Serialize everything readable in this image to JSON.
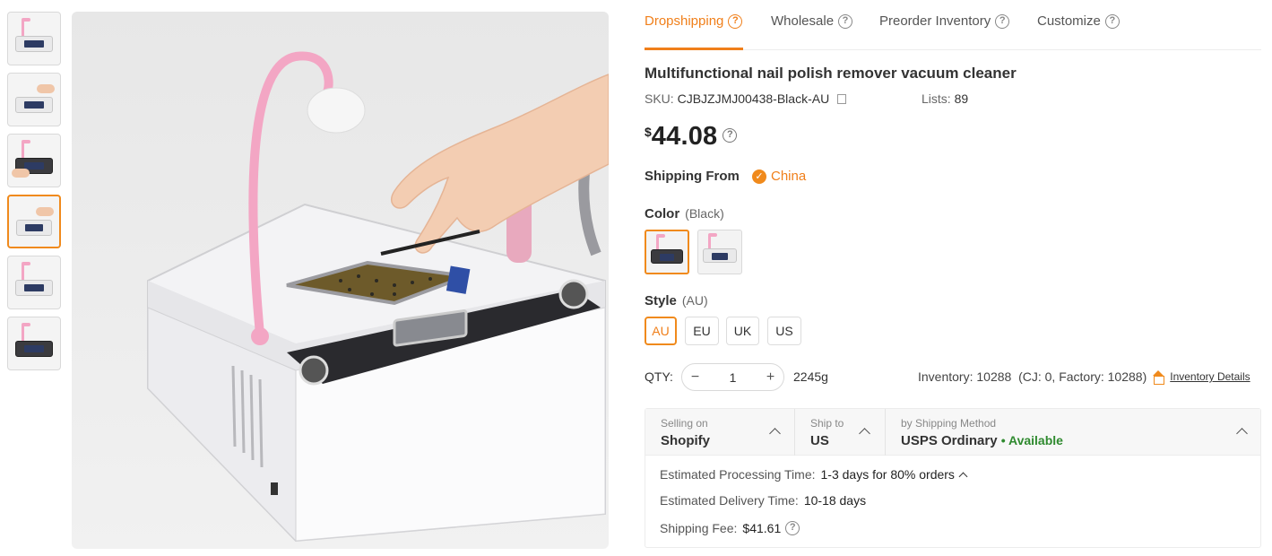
{
  "tabs": [
    {
      "label": "Dropshipping",
      "active": true
    },
    {
      "label": "Wholesale",
      "active": false
    },
    {
      "label": "Preorder Inventory",
      "active": false
    },
    {
      "label": "Customize",
      "active": false
    }
  ],
  "product": {
    "title": "Multifunctional nail polish remover vacuum cleaner",
    "sku_label": "SKU:",
    "sku": "CJBJZJMJ00438-Black-AU",
    "lists_label": "Lists:",
    "lists": "89",
    "currency": "$",
    "price": "44.08"
  },
  "shipping_from": {
    "label": "Shipping From",
    "country": "China"
  },
  "color": {
    "label": "Color",
    "selected": "(Black)",
    "options": [
      "black",
      "white"
    ]
  },
  "style": {
    "label": "Style",
    "selected": "(AU)",
    "options": [
      "AU",
      "EU",
      "UK",
      "US"
    ]
  },
  "qty": {
    "label": "QTY:",
    "minus": "−",
    "plus": "+",
    "value": "1",
    "weight": "2245g"
  },
  "inventory": {
    "text": "Inventory: 10288  (CJ: 0, Factory: 10288)",
    "details_link": "Inventory Details"
  },
  "shipping": {
    "selling_on_label": "Selling on",
    "selling_on": "Shopify",
    "ship_to_label": "Ship to",
    "ship_to": "US",
    "method_label": "by Shipping Method",
    "method": "USPS Ordinary",
    "availability": "• Available",
    "processing_label": "Estimated Processing Time:",
    "processing": "1-3 days for 80% orders",
    "delivery_label": "Estimated Delivery Time:",
    "delivery": "10-18 days",
    "fee_label": "Shipping Fee:",
    "fee": "$41.61"
  },
  "thumbnails": [
    "white-product",
    "white-product-hand",
    "dark-product-hand",
    "white-product-hand-selected",
    "white-product",
    "dark-product"
  ],
  "icons": {
    "help": "question-circle-icon",
    "copy": "copy-icon",
    "check": "check-circle-icon",
    "inventory": "house-icon",
    "chevron": "chevron-up-icon"
  },
  "accent_color": "#f07f1a",
  "available_color": "#2f8a2f"
}
